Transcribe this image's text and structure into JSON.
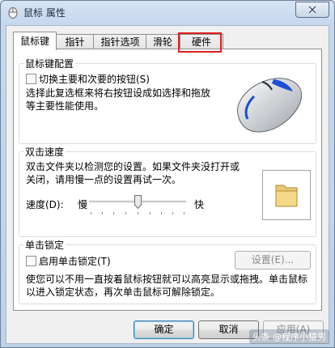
{
  "window": {
    "title": "鼠标 属性"
  },
  "tabs": [
    {
      "label": "鼠标键"
    },
    {
      "label": "指针"
    },
    {
      "label": "指针选项"
    },
    {
      "label": "滑轮"
    },
    {
      "label": "硬件"
    }
  ],
  "buttons_config": {
    "title": "鼠标键配置",
    "checkbox_label": "切换主要和次要的按钮(S)",
    "checked": false,
    "description": "选择此复选框来将右按钮设成如选择和拖放等主要性能使用。"
  },
  "double_click": {
    "title": "双击速度",
    "description": "双击文件夹以检测您的设置。如果文件夹没打开或关闭，请用慢一点的设置再试一次。",
    "speed_label": "速度(D):",
    "slow_label": "慢",
    "fast_label": "快",
    "speed_value": 0.5
  },
  "click_lock": {
    "title": "单击锁定",
    "checkbox_label": "启用单击锁定(T)",
    "checked": false,
    "settings_button": "设置(E)...",
    "description": "使您可以不用一直按着鼠标按钮就可以高亮显示或拖拽。单击鼠标以进入锁定状态，再次单击鼠标可解除锁定。"
  },
  "footer": {
    "ok": "确定",
    "cancel": "取消",
    "apply": "应用(A)"
  },
  "watermark": "头条 @程序小猿男",
  "highlight_color": "#e0201c"
}
